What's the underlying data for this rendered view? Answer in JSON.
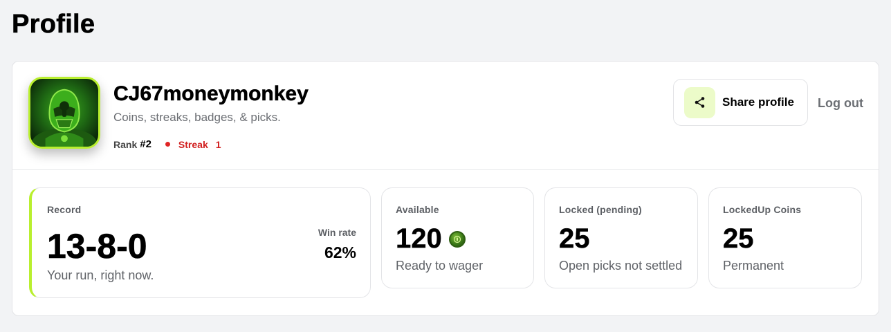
{
  "page": {
    "title": "Profile"
  },
  "profile": {
    "username": "CJ67moneymonkey",
    "tagline": "Coins, streaks, badges, & picks.",
    "rank_label": "Rank",
    "rank_value": "#2",
    "streak_label": "Streak",
    "streak_value": "1",
    "accent_color": "#b9ef2f",
    "streak_color": "#d11f1f"
  },
  "actions": {
    "share_label": "Share profile",
    "share_icon": "share-icon",
    "logout_label": "Log out"
  },
  "stats": {
    "record": {
      "label": "Record",
      "value": "13-8-0",
      "sub": "Your run, right now.",
      "win_rate_label": "Win rate",
      "win_rate_value": "62%"
    },
    "available": {
      "label": "Available",
      "value": "120",
      "icon": "coin-icon",
      "sub": "Ready to wager"
    },
    "locked": {
      "label": "Locked (pending)",
      "value": "25",
      "sub": "Open picks not settled"
    },
    "lockedup": {
      "label": "LockedUp Coins",
      "value": "25",
      "sub": "Permanent"
    }
  }
}
